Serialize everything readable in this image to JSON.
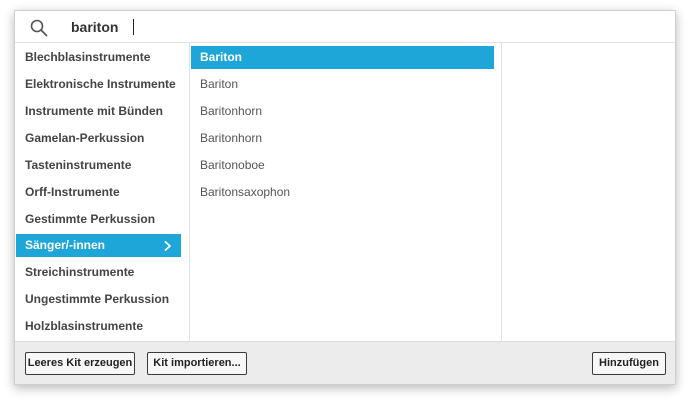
{
  "search": {
    "value": "bariton"
  },
  "categories": [
    {
      "label": "Blechblasinstrumente"
    },
    {
      "label": "Elektronische Instrumente"
    },
    {
      "label": "Instrumente mit Bünden"
    },
    {
      "label": "Gamelan-Perkussion"
    },
    {
      "label": "Tasteninstrumente"
    },
    {
      "label": "Orff-Instrumente"
    },
    {
      "label": "Gestimmte Perkussion"
    },
    {
      "label": "Sänger/-innen",
      "selected": true
    },
    {
      "label": "Streichinstrumente"
    },
    {
      "label": "Ungestimmte Perkussion"
    },
    {
      "label": "Holzblasinstrumente"
    }
  ],
  "instruments": [
    {
      "label": "Bariton",
      "selected": true
    },
    {
      "label": "Bariton"
    },
    {
      "label": "Baritonhorn"
    },
    {
      "label": "Baritonhorn"
    },
    {
      "label": "Baritonoboe"
    },
    {
      "label": "Baritonsaxophon"
    }
  ],
  "footer": {
    "empty_kit_label": "Leeres Kit erzeugen",
    "import_kit_label": "Kit importieren...",
    "add_label": "Hinzufügen"
  },
  "colors": {
    "accent": "#1ea6d8",
    "footer_bg": "#ececec"
  },
  "icons": {
    "search": "search-icon",
    "selected_category": "chevron-right-icon"
  }
}
